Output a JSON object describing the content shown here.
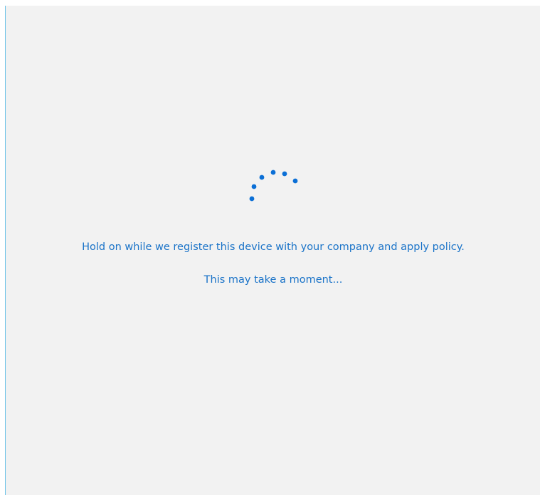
{
  "screen": {
    "message": "Hold on while we register this device with your company and apply policy.",
    "submessage": "This may take a moment...",
    "accent_color": "#1a73c8",
    "background_color": "#f2f2f2",
    "spinner_icon": "progress-ring-dots-icon"
  }
}
